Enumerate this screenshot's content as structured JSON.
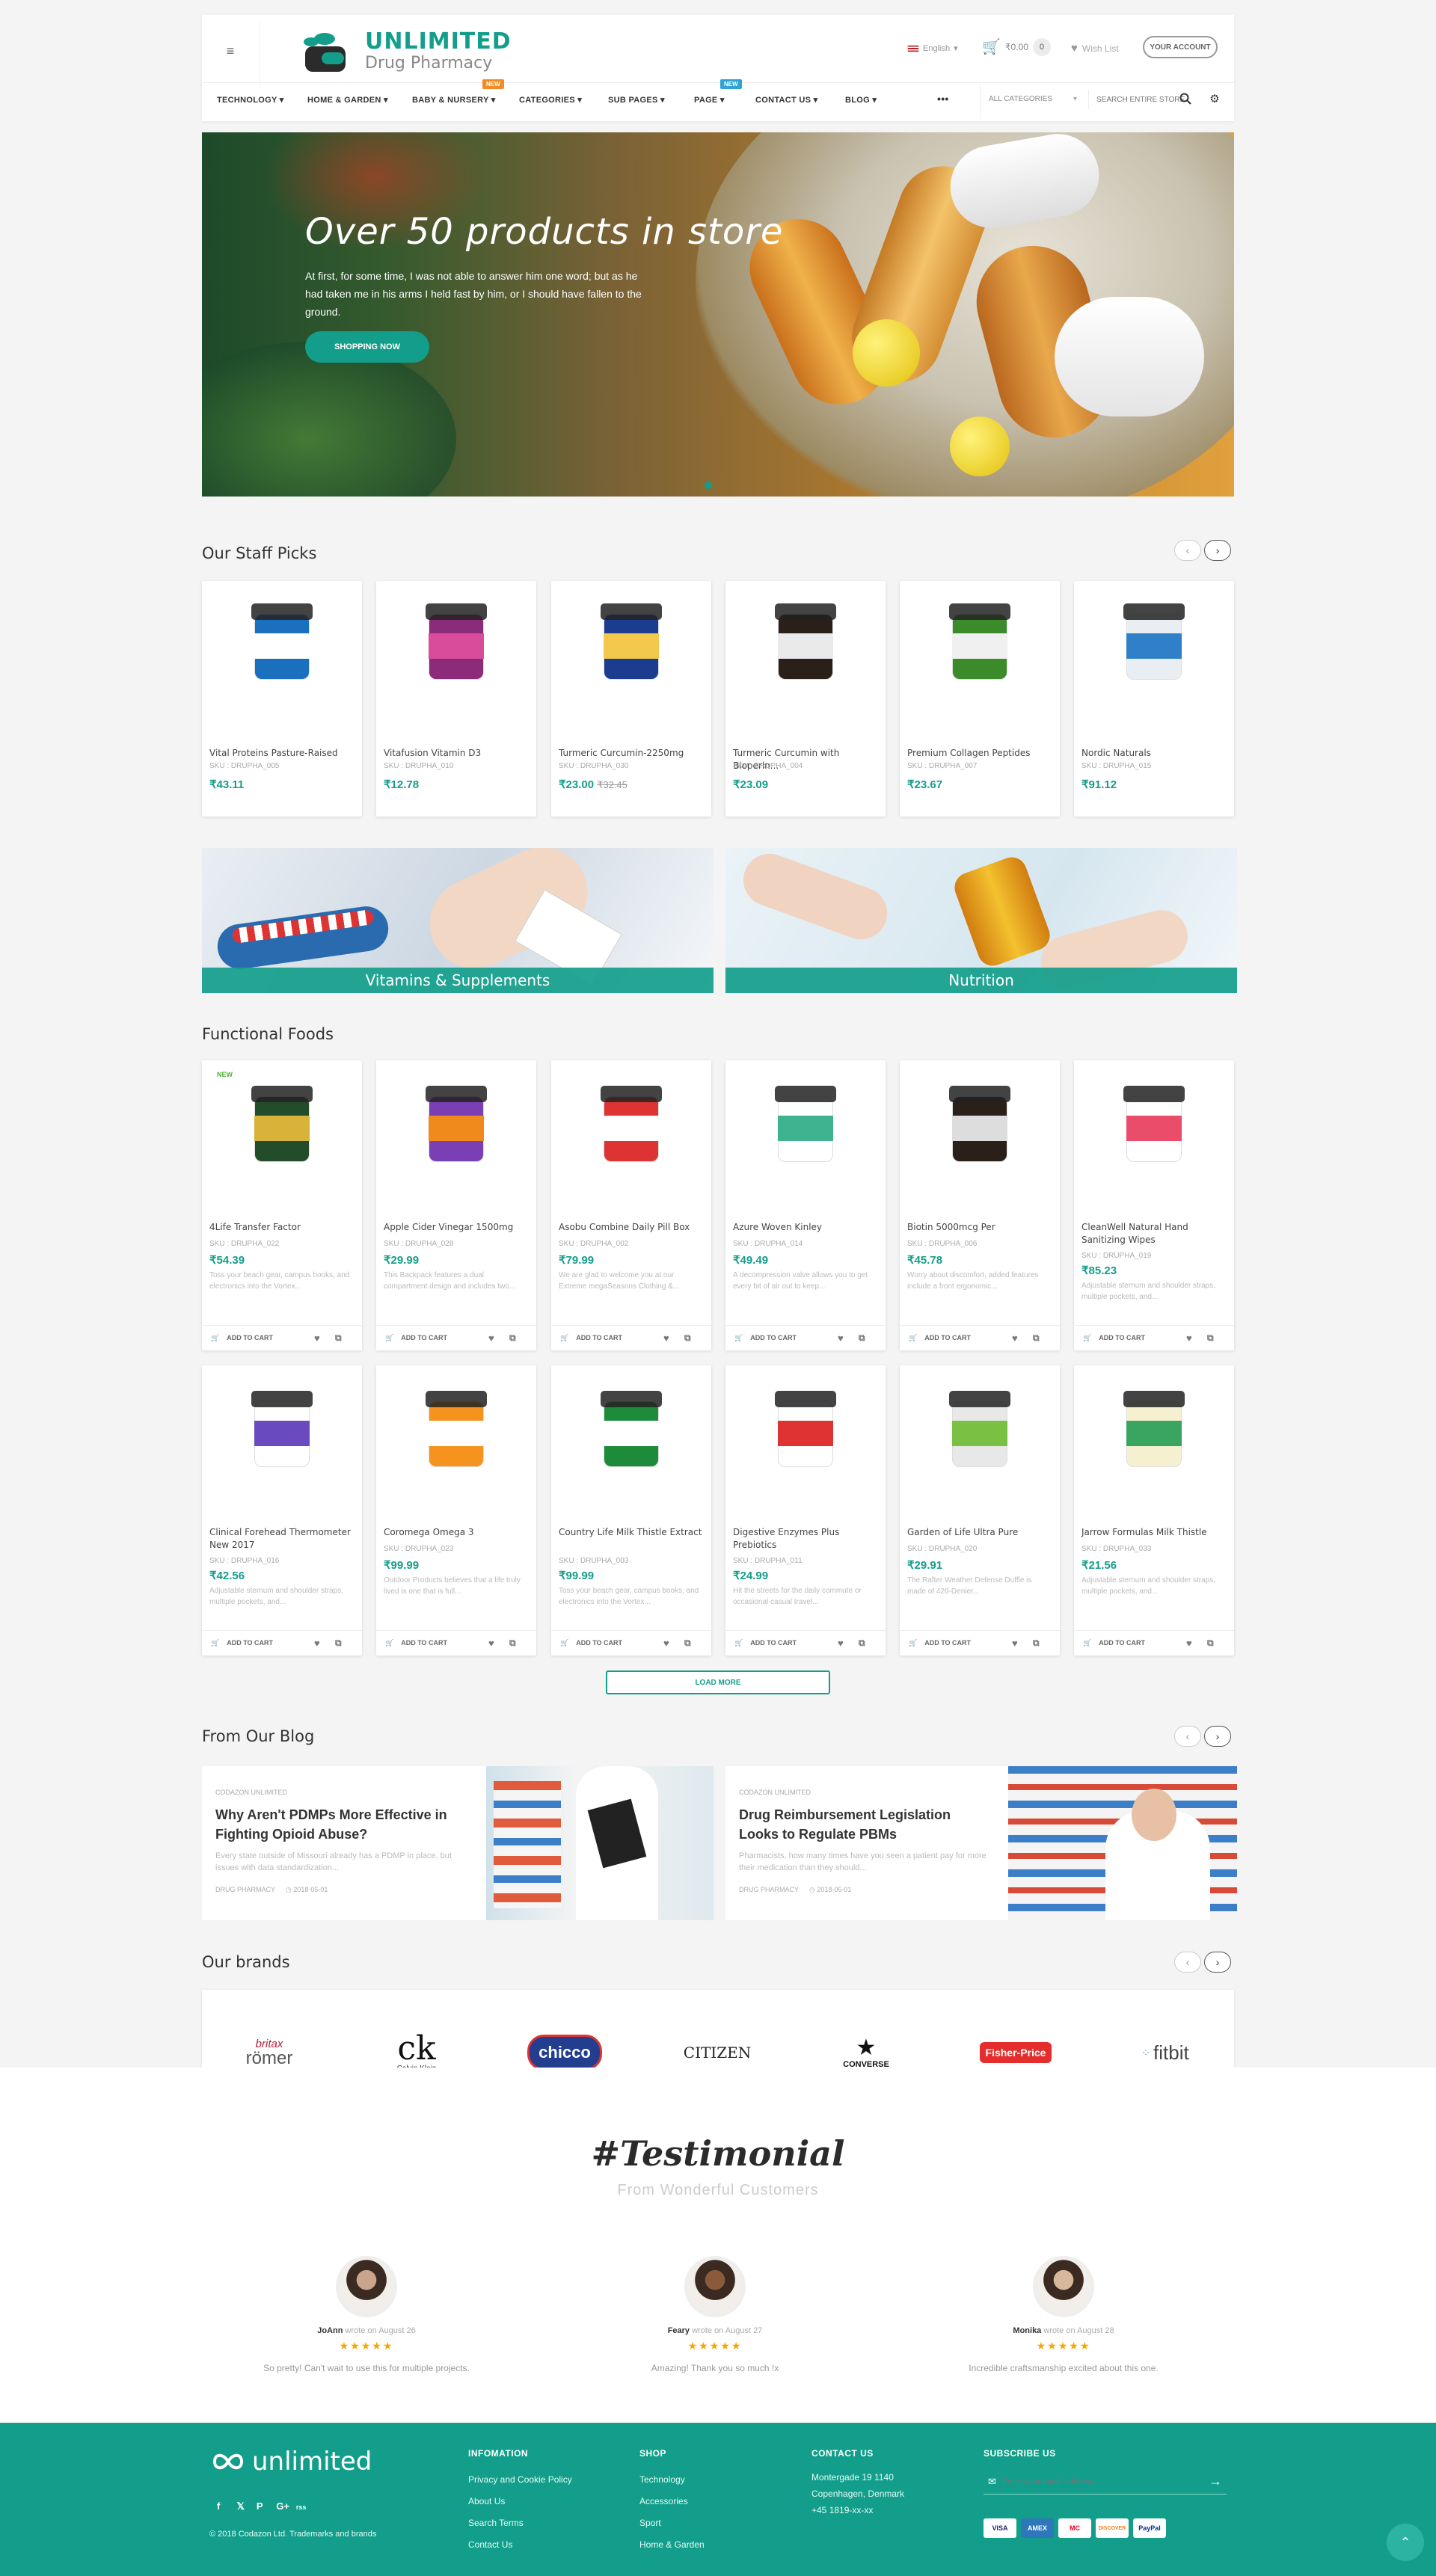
{
  "header": {
    "logo_top": "UNLIMITED",
    "logo_bottom": "Drug Pharmacy",
    "language": "English",
    "cart_total": "₹0.00",
    "cart_count": "0",
    "wishlist": "Wish List",
    "account_button": "YOUR ACCOUNT",
    "nav": [
      "TECHNOLOGY",
      "HOME & GARDEN",
      "BABY & NURSERY",
      "CATEGORIES",
      "SUB PAGES",
      "PAGE",
      "CONTACT US",
      "BLOG"
    ],
    "badge_new": "NEW",
    "more": "•••",
    "category_select": "ALL CATEGORIES",
    "search_placeholder": "SEARCH ENTIRE STORE"
  },
  "hero": {
    "title": "Over 50 products in store",
    "text": "At first, for some time, I was not able to answer him one word; but as he had taken me in his arms I held fast by him, or I should have fallen to the ground.",
    "button": "SHOPPING NOW"
  },
  "staff_picks": {
    "title": "Our Staff Picks",
    "products": [
      {
        "name": "Vital Proteins Pasture-Raised",
        "sku": "SKU : DRUPHA_005",
        "price": "₹43.11",
        "old": ""
      },
      {
        "name": "Vitafusion Vitamin D3",
        "sku": "SKU : DRUPHA_010",
        "price": "₹12.78",
        "old": ""
      },
      {
        "name": "Turmeric Curcumin-2250mg",
        "sku": "SKU : DRUPHA_030",
        "price": "₹23.00",
        "old": "₹32.45"
      },
      {
        "name": "Turmeric Curcumin with Bioperin...",
        "sku": "SKU : DRUPHA_004",
        "price": "₹23.09",
        "old": ""
      },
      {
        "name": "Premium Collagen Peptides",
        "sku": "SKU : DRUPHA_007",
        "price": "₹23.67",
        "old": ""
      },
      {
        "name": "Nordic Naturals",
        "sku": "SKU : DRUPHA_015",
        "price": "₹91.12",
        "old": ""
      }
    ]
  },
  "banners": [
    "Vitamins & Supplements",
    "Nutrition"
  ],
  "functional_foods": {
    "title": "Functional Foods",
    "new_label": "NEW",
    "add_to_cart": "ADD TO CART",
    "load_more": "LOAD MORE",
    "products": [
      {
        "name": "4Life Transfer Factor",
        "sku": "SKU : DRUPHA_022",
        "price": "₹54.39",
        "desc": "Toss your beach gear, campus books, and electronics into the Vortex..."
      },
      {
        "name": "Apple Cider Vinegar 1500mg",
        "sku": "SKU : DRUPHA_028",
        "price": "₹29.99",
        "desc": "This Backpack features a dual compartment design and includes two..."
      },
      {
        "name": "Asobu Combine Daily Pill Box",
        "sku": "SKU : DRUPHA_002",
        "price": "₹79.99",
        "desc": "We are glad to welcome you at our Extreme megaSeasons Clothing &..."
      },
      {
        "name": "Azure Woven Kinley",
        "sku": "SKU : DRUPHA_014",
        "price": "₹49.49",
        "desc": "A decompression valve allows you to get every bit of air out to keep..."
      },
      {
        "name": "Biotin 5000mcg Per",
        "sku": "SKU : DRUPHA_006",
        "price": "₹45.78",
        "desc": "Worry about discomfort, added features include a front ergonomic..."
      },
      {
        "name": "CleanWell Natural Hand Sanitizing Wipes",
        "sku": "SKU : DRUPHA_019",
        "price": "₹85.23",
        "desc": "Adjustable sternum and shoulder straps, multiple pockets, and..."
      },
      {
        "name": "Clinical Forehead Thermometer New 2017",
        "sku": "SKU : DRUPHA_016",
        "price": "₹42.56",
        "desc": "Adjustable sternum and shoulder straps, multiple pockets, and..."
      },
      {
        "name": "Coromega Omega 3",
        "sku": "SKU : DRUPHA_023",
        "price": "₹99.99",
        "desc": "Outdoor Products believes that a life truly lived is one that is full..."
      },
      {
        "name": "Country Life Milk Thistle Extract",
        "sku": "SKU : DRUPHA_003",
        "price": "₹99.99",
        "desc": "Toss your beach gear, campus books, and electronics into the Vortex..."
      },
      {
        "name": "Digestive Enzymes Plus Prebiotics",
        "sku": "SKU : DRUPHA_011",
        "price": "₹24.99",
        "desc": "Hit the streets for the daily commute or occasional casual travel..."
      },
      {
        "name": "Garden of Life Ultra Pure",
        "sku": "SKU : DRUPHA_020",
        "price": "₹29.91",
        "desc": "The Rafter Weather Defense Duffle is made of 420-Denier..."
      },
      {
        "name": "Jarrow Formulas Milk Thistle",
        "sku": "SKU : DRUPHA_033",
        "price": "₹21.56",
        "desc": "Adjustable sternum and shoulder straps, multiple pockets, and..."
      }
    ]
  },
  "blog": {
    "title": "From Our Blog",
    "posts": [
      {
        "author": "CODAZON UNLIMITED",
        "title": "Why Aren't PDMPs More Effective in Fighting Opioid Abuse?",
        "excerpt": "Every state outside of Missouri already has a PDMP in place, but issues with data standardization...",
        "category": "DRUG PHARMACY",
        "date": "2018-05-01"
      },
      {
        "author": "CODAZON UNLIMITED",
        "title": "Drug Reimbursement Legislation Looks to Regulate PBMs",
        "excerpt": "Pharmacists, how many times have you seen a patient pay for more their medication than they should...",
        "category": "DRUG PHARMACY",
        "date": "2018-05-01"
      }
    ]
  },
  "brands": {
    "title": "Our brands",
    "items": [
      {
        "top": "britax",
        "bottom": "römer"
      },
      {
        "top": "ck",
        "bottom": "Calvin Klein"
      },
      {
        "top": "chicco",
        "bottom": ""
      },
      {
        "top": "CITIZEN",
        "bottom": ""
      },
      {
        "top": "★",
        "bottom": "CONVERSE"
      },
      {
        "top": "Fisher-Price",
        "bottom": ""
      },
      {
        "top": "fitbit",
        "bottom": ""
      }
    ]
  },
  "testimonial": {
    "title": "#Testimonial",
    "subtitle": "From Wonderful Customers",
    "wrote": "wrote on",
    "items": [
      {
        "name": "JoAnn",
        "date": "August 26",
        "text": "So pretty! Can't wait to use this for multiple projects."
      },
      {
        "name": "Feary",
        "date": "August 27",
        "text": "Amazing! Thank you so much !x"
      },
      {
        "name": "Monika",
        "date": "August 28",
        "text": "Incredible craftsmanship excited about this one."
      }
    ]
  },
  "footer": {
    "logo": "unlimited",
    "copyright": "© 2018 Codazon Ltd. Trademarks and brands",
    "information_title": "INFOMATION",
    "information": [
      "Privacy and Cookie Policy",
      "About Us",
      "Search Terms",
      "Contact Us"
    ],
    "shop_title": "SHOP",
    "shop": [
      "Technology",
      "Accessories",
      "Sport",
      "Home & Garden"
    ],
    "contact_title": "CONTACT US",
    "contact": [
      "Montergade 19 1140",
      "Copenhagen, Denmark",
      "+45 1819-xx-xx"
    ],
    "subscribe_title": "SUBSCRIBE US",
    "email_placeholder": "Enter your email address",
    "payments": [
      "VISA",
      "AMEX",
      "MC",
      "DISCOVER",
      "PayPal"
    ],
    "social": [
      "f",
      "𝕏",
      "P",
      "G+",
      "rss"
    ]
  },
  "colors": {
    "accent": "#139e8b",
    "nav_new_badge": "#f28c28",
    "page_new_badge": "#2fa3d4",
    "price": "#139e8b",
    "stars": "#f7a600"
  }
}
